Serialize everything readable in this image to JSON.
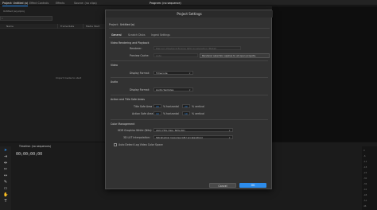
{
  "tabs": {
    "project": "Project: Untitled (a)",
    "effect_controls": "Effect Controls",
    "effects": "Effects",
    "source": "Source: (no clips)",
    "program": "Program: (no sequence)"
  },
  "project_panel": {
    "path": "Untitled (a).prproj",
    "columns": [
      "Name",
      "Frame Rate",
      "Media Start"
    ],
    "empty_message": "Import media to start"
  },
  "timeline": {
    "title": "Timeline: (no sequences)",
    "timecode": "00;00;00;00",
    "drop_hint": "Drop media here to create sequence"
  },
  "meter_ticks": [
    "0",
    "-6",
    "-12",
    "-18",
    "-24",
    "-30",
    "-36",
    "-42",
    "-48",
    "-54",
    "dB"
  ],
  "dialog": {
    "title": "Project Settings",
    "project_label": "Project:",
    "project_name": "Untitled (a)",
    "tabs": [
      "General",
      "Scratch Disks",
      "Ingest Settings"
    ],
    "video_rendering": {
      "heading": "Video Rendering and Playback",
      "renderer_label": "Renderer:",
      "renderer_value": "Mercury Playback Engine GPU Acceleration (Metal)",
      "preview_cache_label": "Preview Cache:",
      "preview_cache_value": "Auto",
      "hint": "Renderer selection applies to all open projects."
    },
    "video": {
      "heading": "Video",
      "display_format_label": "Display Format:",
      "display_format_value": "Timecode"
    },
    "audio": {
      "heading": "Audio",
      "display_format_label": "Display Format:",
      "display_format_value": "Audio Samples"
    },
    "safe_areas": {
      "heading": "Action and Title Safe Areas",
      "title_label": "Title Safe Area",
      "title_h": "20",
      "title_v": "20",
      "action_label": "Action Safe Area",
      "action_h": "10",
      "action_v": "10",
      "horizontal": "% horizontal",
      "vertical": "% vertical"
    },
    "color": {
      "heading": "Color Management",
      "hdr_label": "HDR Graphics White (Nits):",
      "hdr_value": "203 (75% HLG, 58% PQ)",
      "lut_label": "3D LUT Interpolation:",
      "lut_value": "Tetrahedral (requires GPU acceleration)",
      "linear_label": "Auto Detect Log Video Color Space"
    },
    "cancel": "Cancel",
    "ok": "OK"
  },
  "colors": {
    "accent": "#2d8ceb",
    "dialog_bg": "#323232",
    "panel_bg": "#1d1d1d"
  }
}
